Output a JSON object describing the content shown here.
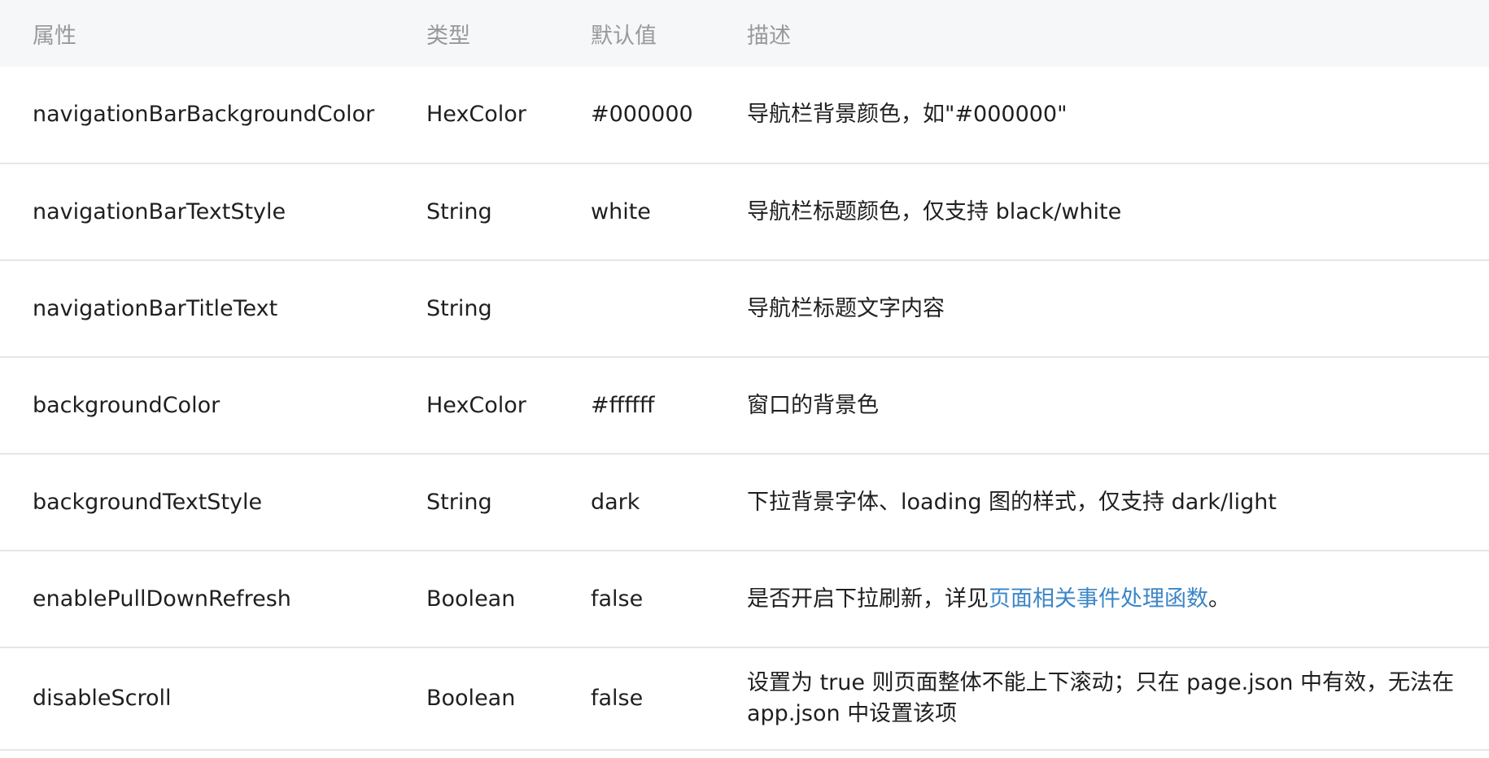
{
  "header": {
    "prop": "属性",
    "type": "类型",
    "default": "默认值",
    "desc": "描述"
  },
  "rows": [
    {
      "prop": "navigationBarBackgroundColor",
      "type": "HexColor",
      "default": "#000000",
      "desc": "导航栏背景颜色，如\"#000000\""
    },
    {
      "prop": "navigationBarTextStyle",
      "type": "String",
      "default": "white",
      "desc": "导航栏标题颜色，仅支持 black/white"
    },
    {
      "prop": "navigationBarTitleText",
      "type": "String",
      "default": "",
      "desc": "导航栏标题文字内容"
    },
    {
      "prop": "backgroundColor",
      "type": "HexColor",
      "default": "#ffffff",
      "desc": "窗口的背景色"
    },
    {
      "prop": "backgroundTextStyle",
      "type": "String",
      "default": "dark",
      "desc": "下拉背景字体、loading 图的样式，仅支持 dark/light"
    },
    {
      "prop": "enablePullDownRefresh",
      "type": "Boolean",
      "default": "false",
      "desc_prefix": "是否开启下拉刷新，详见",
      "desc_link": "页面相关事件处理函数",
      "desc_suffix": "。"
    },
    {
      "prop": "disableScroll",
      "type": "Boolean",
      "default": "false",
      "desc": "设置为 true 则页面整体不能上下滚动；只在 page.json 中有效，无法在 app.json 中设置该项"
    }
  ],
  "colors": {
    "header_bg": "#f6f7f8",
    "header_text": "#999999",
    "body_text": "#1f1f1f",
    "link": "#3b86c7",
    "divider": "#e6e6e6"
  }
}
